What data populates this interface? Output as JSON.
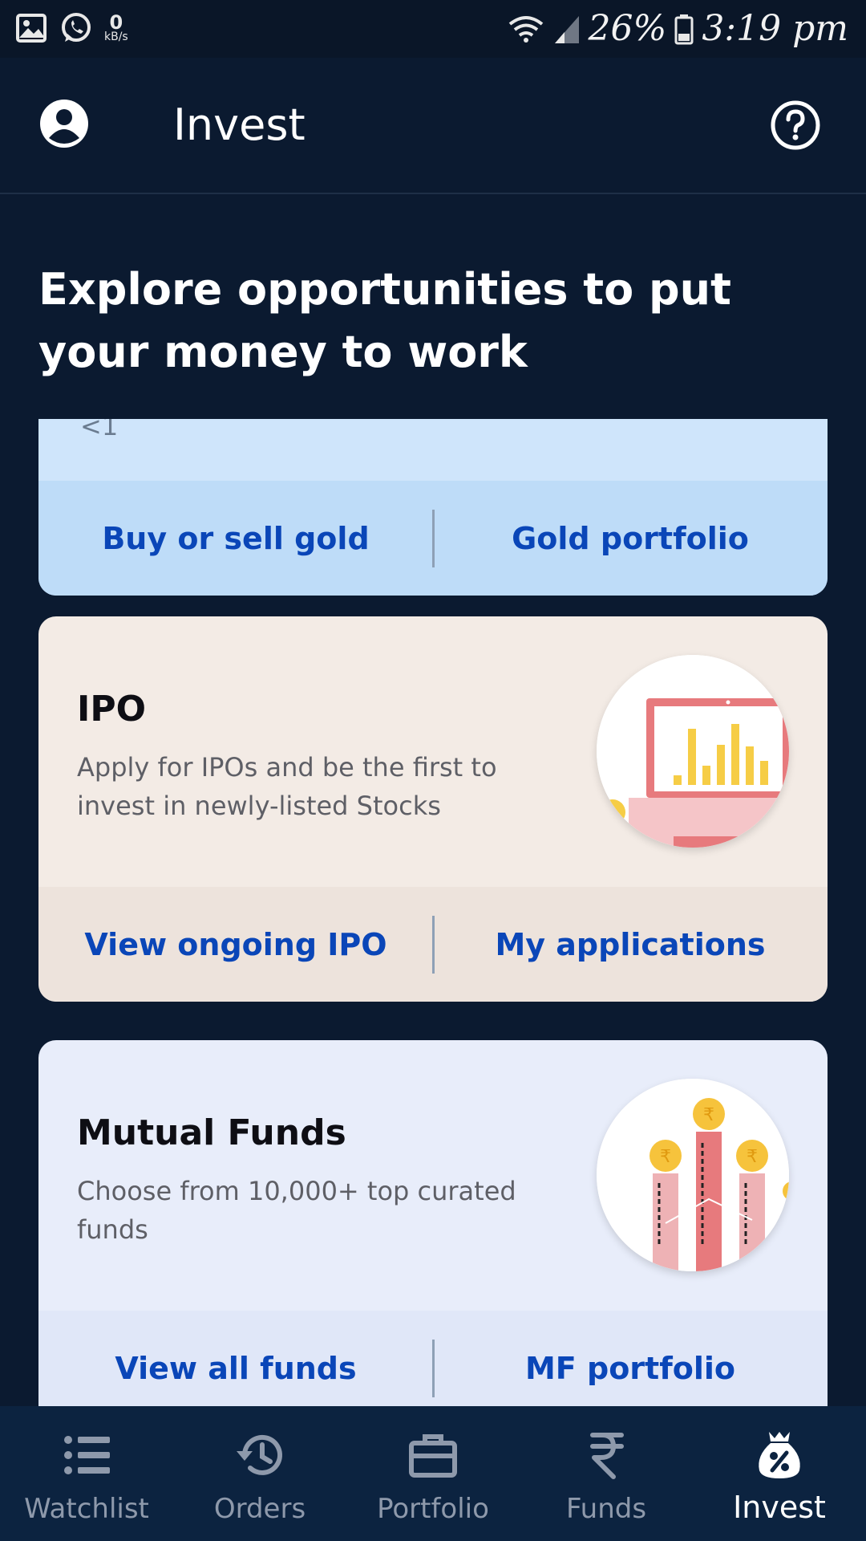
{
  "status_bar": {
    "net_speed_value": "0",
    "net_speed_unit": "kB/s",
    "battery": "26%",
    "time": "3:19 pm",
    "icons": [
      "gallery-icon",
      "whatsapp-icon",
      "wifi-icon",
      "signal-icon",
      "battery-icon"
    ]
  },
  "header": {
    "title": "Invest",
    "left_icon": "account-icon",
    "right_icon": "help-icon"
  },
  "hero": {
    "heading": "Explore opportunities to put your money to work"
  },
  "cards": {
    "gold": {
      "peek_text": "<1",
      "action_left": "Buy or sell gold",
      "action_right": "Gold portfolio",
      "colors": {
        "background": "#cfe5fb",
        "actions": "#bedcf8"
      }
    },
    "ipo": {
      "title": "IPO",
      "description": "Apply for IPOs and be the first to invest in newly-listed Stocks",
      "action_left": "View ongoing IPO",
      "action_right": "My applications",
      "illustration": "laptop-chart-illustration",
      "colors": {
        "background": "#f3ebe5",
        "actions": "#ede3dc"
      }
    },
    "mutual_funds": {
      "title": "Mutual Funds",
      "description": "Choose from 10,000+ top curated funds",
      "action_left": "View all funds",
      "action_right": "MF portfolio",
      "illustration": "rupee-coins-bars-illustration",
      "colors": {
        "background": "#e8edfa",
        "actions": "#e0e7f8"
      }
    }
  },
  "bottom_nav": {
    "items": [
      {
        "label": "Watchlist",
        "icon": "list-icon",
        "active": false
      },
      {
        "label": "Orders",
        "icon": "history-icon",
        "active": false
      },
      {
        "label": "Portfolio",
        "icon": "briefcase-icon",
        "active": false
      },
      {
        "label": "Funds",
        "icon": "rupee-icon",
        "active": false
      },
      {
        "label": "Invest",
        "icon": "money-bag-icon",
        "active": true
      }
    ]
  },
  "colors": {
    "page_background": "#0b1a30",
    "link_blue": "#0a46b8",
    "nav_inactive": "#8e99ab",
    "nav_active": "#ffffff"
  }
}
